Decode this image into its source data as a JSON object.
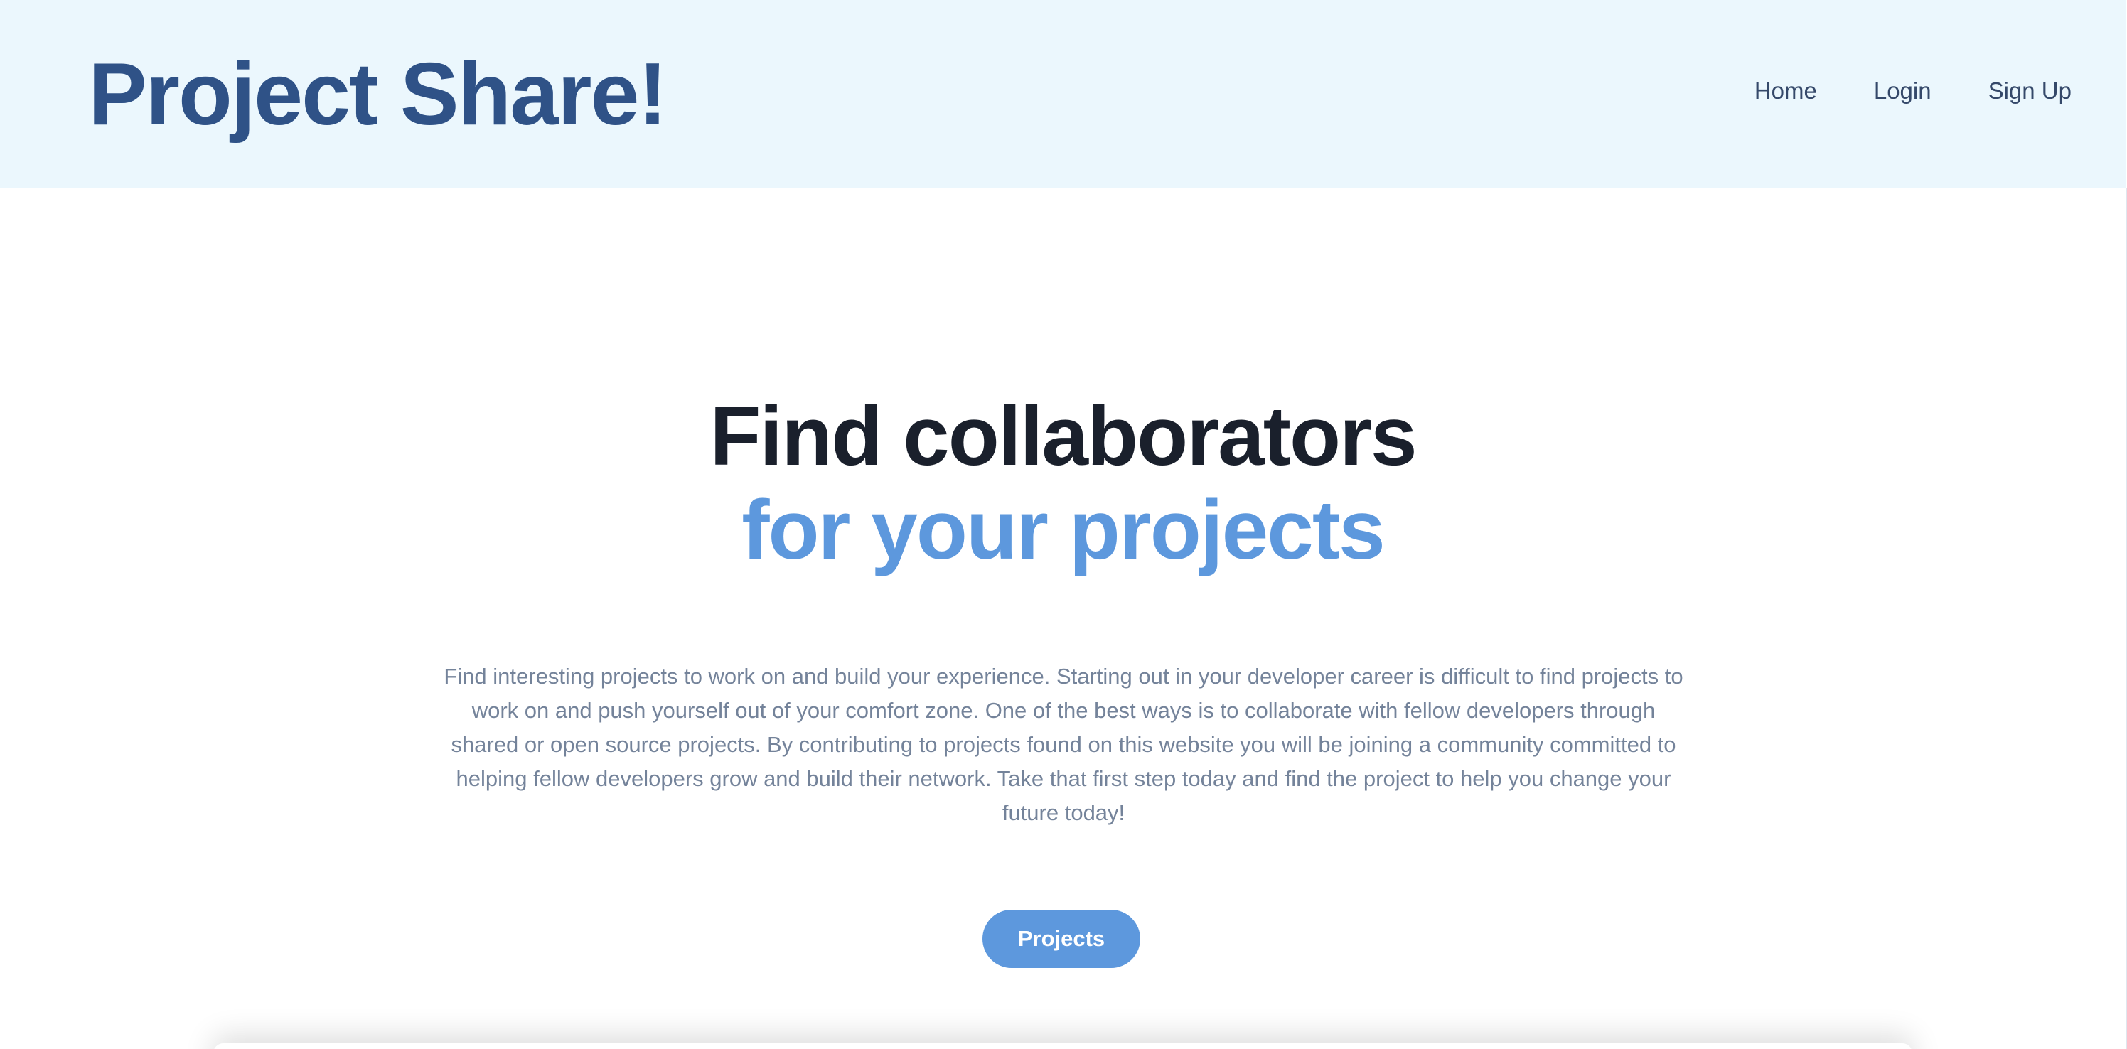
{
  "brand": {
    "title": "Project Share!"
  },
  "nav": {
    "items": [
      {
        "label": "Home"
      },
      {
        "label": "Login"
      },
      {
        "label": "Sign Up"
      }
    ]
  },
  "hero": {
    "title_line1": "Find collaborators",
    "title_line2": "for your projects",
    "description": "Find interesting projects to work on and build your experience. Starting out in your developer career is difficult to find projects to work on and push yourself out of your comfort zone. One of the best ways is to collaborate with fellow developers through shared or open source projects. By contributing to projects found on this website you will be joining a community committed to helping fellow developers grow and build their network. Take that first step today and find the project to help you change your future today!",
    "cta_label": "Projects"
  },
  "colors": {
    "header_bg": "#ebf7fd",
    "brand": "#2f5287",
    "accent": "#5d98dd",
    "heading": "#1a202c",
    "body_text": "#74839a"
  }
}
